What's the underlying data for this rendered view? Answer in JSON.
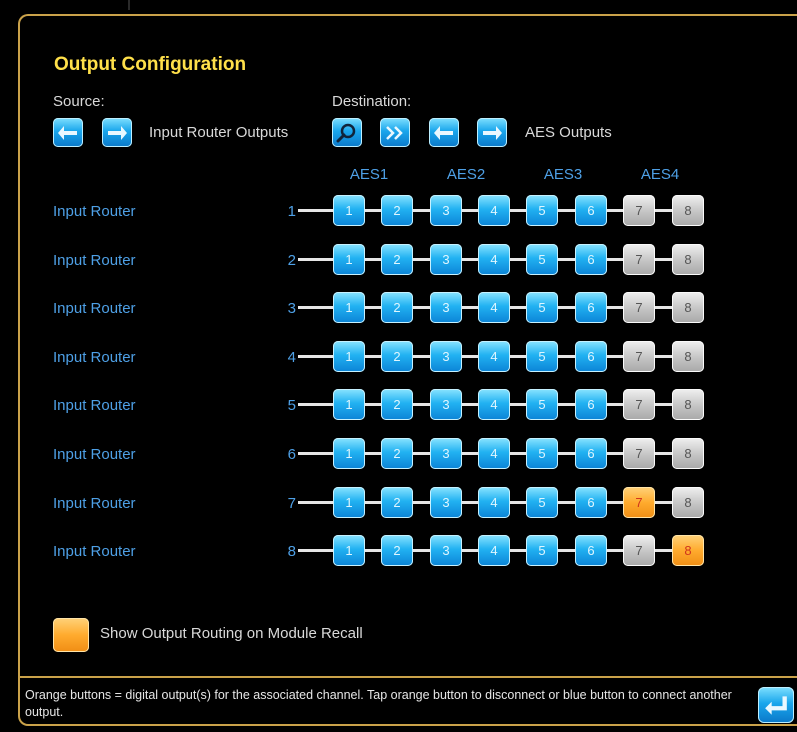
{
  "title": "Output Configuration",
  "source": {
    "label": "Source:",
    "value": "Input Router Outputs"
  },
  "destination": {
    "label": "Destination:",
    "value": "AES Outputs"
  },
  "groups": [
    "AES1",
    "AES2",
    "AES3",
    "AES4"
  ],
  "rows": [
    {
      "label": "Input Router",
      "num": "1",
      "cells": [
        {
          "n": "1",
          "state": "blue"
        },
        {
          "n": "2",
          "state": "blue"
        },
        {
          "n": "3",
          "state": "blue"
        },
        {
          "n": "4",
          "state": "blue"
        },
        {
          "n": "5",
          "state": "blue"
        },
        {
          "n": "6",
          "state": "blue"
        },
        {
          "n": "7",
          "state": "gray"
        },
        {
          "n": "8",
          "state": "gray"
        }
      ]
    },
    {
      "label": "Input Router",
      "num": "2",
      "cells": [
        {
          "n": "1",
          "state": "blue"
        },
        {
          "n": "2",
          "state": "blue"
        },
        {
          "n": "3",
          "state": "blue"
        },
        {
          "n": "4",
          "state": "blue"
        },
        {
          "n": "5",
          "state": "blue"
        },
        {
          "n": "6",
          "state": "blue"
        },
        {
          "n": "7",
          "state": "gray"
        },
        {
          "n": "8",
          "state": "gray"
        }
      ]
    },
    {
      "label": "Input Router",
      "num": "3",
      "cells": [
        {
          "n": "1",
          "state": "blue"
        },
        {
          "n": "2",
          "state": "blue"
        },
        {
          "n": "3",
          "state": "blue"
        },
        {
          "n": "4",
          "state": "blue"
        },
        {
          "n": "5",
          "state": "blue"
        },
        {
          "n": "6",
          "state": "blue"
        },
        {
          "n": "7",
          "state": "gray"
        },
        {
          "n": "8",
          "state": "gray"
        }
      ]
    },
    {
      "label": "Input Router",
      "num": "4",
      "cells": [
        {
          "n": "1",
          "state": "blue"
        },
        {
          "n": "2",
          "state": "blue"
        },
        {
          "n": "3",
          "state": "blue"
        },
        {
          "n": "4",
          "state": "blue"
        },
        {
          "n": "5",
          "state": "blue"
        },
        {
          "n": "6",
          "state": "blue"
        },
        {
          "n": "7",
          "state": "gray"
        },
        {
          "n": "8",
          "state": "gray"
        }
      ]
    },
    {
      "label": "Input Router",
      "num": "5",
      "cells": [
        {
          "n": "1",
          "state": "blue"
        },
        {
          "n": "2",
          "state": "blue"
        },
        {
          "n": "3",
          "state": "blue"
        },
        {
          "n": "4",
          "state": "blue"
        },
        {
          "n": "5",
          "state": "blue"
        },
        {
          "n": "6",
          "state": "blue"
        },
        {
          "n": "7",
          "state": "gray"
        },
        {
          "n": "8",
          "state": "gray"
        }
      ]
    },
    {
      "label": "Input Router",
      "num": "6",
      "cells": [
        {
          "n": "1",
          "state": "blue"
        },
        {
          "n": "2",
          "state": "blue"
        },
        {
          "n": "3",
          "state": "blue"
        },
        {
          "n": "4",
          "state": "blue"
        },
        {
          "n": "5",
          "state": "blue"
        },
        {
          "n": "6",
          "state": "blue"
        },
        {
          "n": "7",
          "state": "gray"
        },
        {
          "n": "8",
          "state": "gray"
        }
      ]
    },
    {
      "label": "Input Router",
      "num": "7",
      "cells": [
        {
          "n": "1",
          "state": "blue"
        },
        {
          "n": "2",
          "state": "blue"
        },
        {
          "n": "3",
          "state": "blue"
        },
        {
          "n": "4",
          "state": "blue"
        },
        {
          "n": "5",
          "state": "blue"
        },
        {
          "n": "6",
          "state": "blue"
        },
        {
          "n": "7",
          "state": "orange"
        },
        {
          "n": "8",
          "state": "gray"
        }
      ]
    },
    {
      "label": "Input Router",
      "num": "8",
      "cells": [
        {
          "n": "1",
          "state": "blue"
        },
        {
          "n": "2",
          "state": "blue"
        },
        {
          "n": "3",
          "state": "blue"
        },
        {
          "n": "4",
          "state": "blue"
        },
        {
          "n": "5",
          "state": "blue"
        },
        {
          "n": "6",
          "state": "blue"
        },
        {
          "n": "7",
          "state": "gray"
        },
        {
          "n": "8",
          "state": "orange"
        }
      ]
    }
  ],
  "recall_option": {
    "label": "Show Output Routing on Module Recall",
    "checked": true
  },
  "footer_text": "Orange buttons = digital output(s) for the associated channel. Tap orange button to disconnect or blue button to connect another output.",
  "colors": {
    "accent_border": "#caa24a",
    "title": "#ffe04a",
    "link_blue": "#4ea0e6",
    "active_orange": "#ffab2e"
  }
}
